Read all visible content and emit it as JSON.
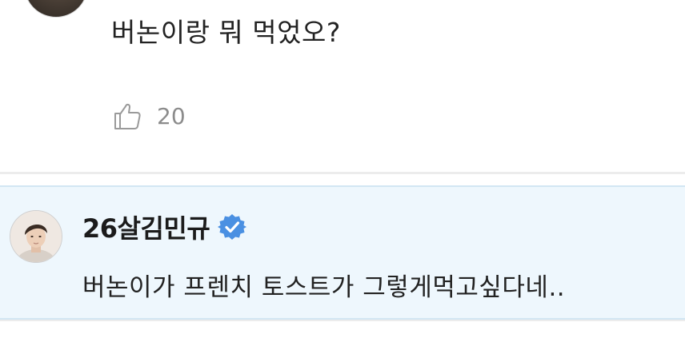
{
  "top_comment": {
    "text": "버논이랑 뭐 먹었오?",
    "like_count": "20",
    "icons": {
      "like": "thumbs-up-icon"
    }
  },
  "reply": {
    "author": "26살김민규",
    "verified": true,
    "text": "버논이가 프렌치 토스트가 그렇게먹고싶다네..",
    "icons": {
      "verified": "verified-badge-icon"
    }
  },
  "colors": {
    "reply_background": "#eef7fd",
    "verified_badge": "#4a90e2",
    "muted_text": "#8c8c8c",
    "body_text": "#222222"
  }
}
